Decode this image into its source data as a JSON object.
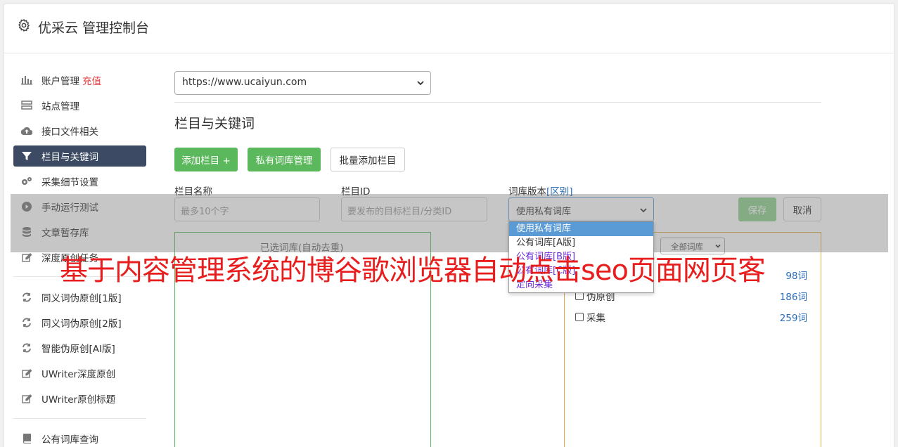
{
  "header": {
    "title": "优采云 管理控制台",
    "icon": "gear-icon"
  },
  "sidebar": {
    "items": [
      {
        "label": "账户管理",
        "extra": "充值",
        "icon": "bar-chart-icon"
      },
      {
        "label": "站点管理",
        "icon": "server-icon"
      },
      {
        "label": "接口文件相关",
        "icon": "cloud-upload-icon"
      },
      {
        "label": "栏目与关键词",
        "icon": "filter-icon",
        "active": true
      },
      {
        "label": "采集细节设置",
        "icon": "cogs-icon"
      },
      {
        "label": "手动运行测试",
        "icon": "play-circle-icon"
      },
      {
        "label": "文章暂存库",
        "icon": "database-icon"
      },
      {
        "label": "深度原创任务",
        "icon": "edit-icon"
      },
      {
        "label": "同义词伪原创[1版]",
        "icon": "refresh-icon"
      },
      {
        "label": "同义词伪原创[2版]",
        "icon": "refresh-icon"
      },
      {
        "label": "智能伪原创[AI版]",
        "icon": "refresh-icon"
      },
      {
        "label": "UWriter深度原创",
        "icon": "edit-icon"
      },
      {
        "label": "UWriter原创标题",
        "icon": "edit-icon"
      },
      {
        "label": "公有词库查询",
        "icon": "book-icon"
      }
    ]
  },
  "site_select": {
    "value": "https://www.ucaiyun.com"
  },
  "section": {
    "title": "栏目与关键词"
  },
  "toolbar": {
    "add_column": "添加栏目 +",
    "private_lib": "私有词库管理",
    "batch_add": "批量添加栏目"
  },
  "form": {
    "name_label": "栏目名称",
    "name_placeholder": "最多10个字",
    "id_label": "栏目ID",
    "id_placeholder": "要发布的目标栏目/分类ID",
    "version_label": "词库版本",
    "version_link": "[区别]",
    "version_value": "使用私有词库",
    "save": "保存",
    "cancel": "取消"
  },
  "dropdown": {
    "options": [
      "使用私有词库",
      "公有词库[A版]",
      "公有词库[B版]",
      "公有词库[C版]",
      "定向采集"
    ]
  },
  "left_panel": {
    "title": "已选词库(自动去重)"
  },
  "right_panel": {
    "filter": "全部词库",
    "rows": [
      {
        "label": "",
        "count": "98词"
      },
      {
        "label": "伪原创",
        "count": "186词"
      },
      {
        "label": "采集",
        "count": "259词"
      }
    ]
  },
  "watermark": "基于内容管理系统的博谷歌浏览器自动点击seo页面网页客"
}
